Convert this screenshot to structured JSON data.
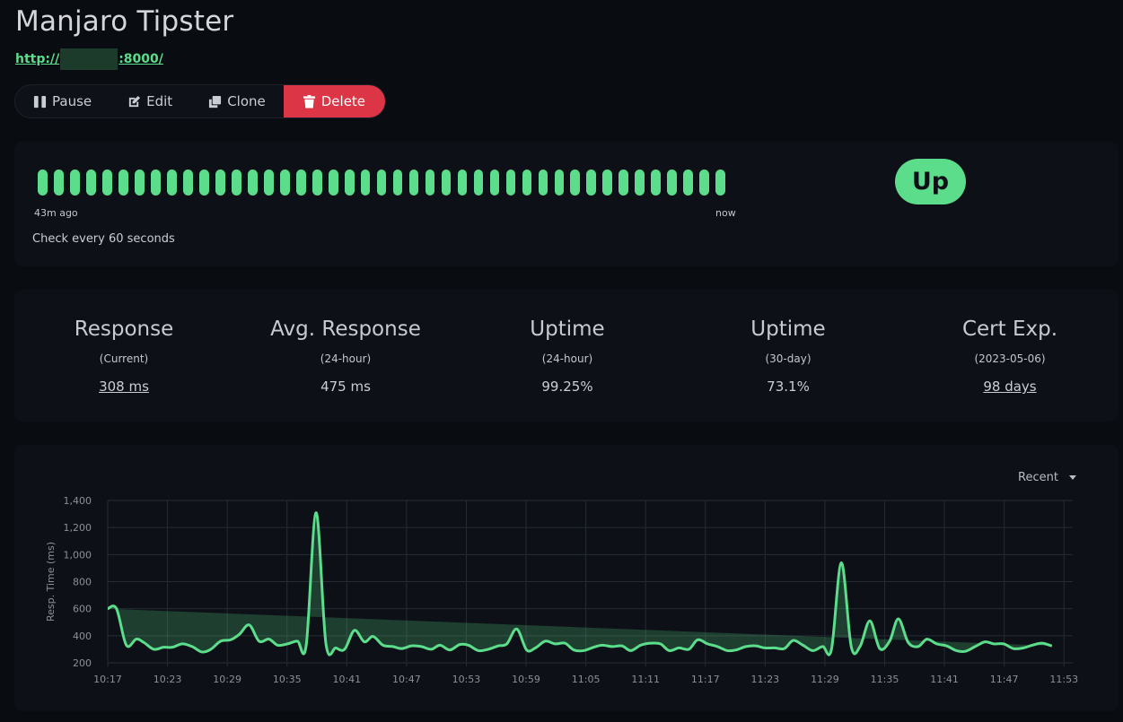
{
  "monitor": {
    "title": "Manjaro Tipster",
    "url_prefix": "http://",
    "url_suffix": ":8000/"
  },
  "actions": {
    "pause": "Pause",
    "edit": "Edit",
    "clone": "Clone",
    "delete": "Delete"
  },
  "heartbeat": {
    "count": 43,
    "status_color": "#5cdd8b",
    "start_label": "43m ago",
    "end_label": "now",
    "interval_text": "Check every 60 seconds",
    "status": "Up"
  },
  "stats": [
    {
      "title": "Response",
      "sub": "(Current)",
      "value": "308 ms",
      "link": true
    },
    {
      "title": "Avg. Response",
      "sub": "(24-hour)",
      "value": "475 ms",
      "link": false
    },
    {
      "title": "Uptime",
      "sub": "(24-hour)",
      "value": "99.25%",
      "link": false
    },
    {
      "title": "Uptime",
      "sub": "(30-day)",
      "value": "73.1%",
      "link": false
    },
    {
      "title": "Cert Exp.",
      "sub": "(2023-05-06)",
      "value": "98 days",
      "link": true
    }
  ],
  "chart_range": "Recent",
  "chart_data": {
    "type": "area",
    "ylabel": "Resp. Time (ms)",
    "ylim": [
      200,
      1400
    ],
    "yticks": [
      200,
      400,
      600,
      800,
      1000,
      1200,
      1400
    ],
    "ytick_labels": [
      "200",
      "400",
      "600",
      "800",
      "1,000",
      "1,200",
      "1,400"
    ],
    "xlim": [
      10.5,
      98.5
    ],
    "xticks": [
      10.5,
      16.5,
      22.5,
      28.5,
      34.5,
      40.5,
      46.5,
      52.5,
      58.5,
      64.5,
      70.5,
      76.5,
      82.5,
      88.5,
      94.5
    ],
    "xtick_labels": [
      "10:17",
      "10:23",
      "10:29",
      "10:35",
      "10:41",
      "10:47",
      "10:53",
      "10:59",
      "11:05",
      "11:11",
      "11:17",
      "11:23",
      "11:29",
      "11:35",
      "11:41",
      "11:47",
      "11:53"
    ],
    "grid": true,
    "color": "#5cdd8b",
    "x": [
      10.5,
      11.3,
      12.2,
      13.1,
      13.8,
      14.7,
      15.6,
      16.4,
      17.3,
      18.2,
      19.1,
      19.9,
      20.8,
      21.7,
      22.5,
      23.4,
      24.3,
      25.2,
      26.0,
      26.9,
      27.8,
      28.6,
      29.5,
      30.4,
      31.3,
      32.1,
      33.0,
      33.9,
      34.7,
      35.6,
      36.5,
      37.3,
      38.2,
      39.1,
      40.0,
      40.8,
      41.7,
      42.6,
      43.4,
      44.3,
      45.2,
      46.1,
      46.9,
      47.8,
      48.7,
      49.5,
      50.4,
      51.3,
      52.2,
      53.0,
      53.9,
      54.8,
      55.6,
      56.5,
      57.4,
      58.2,
      59.1,
      60.0,
      60.9,
      61.7,
      62.6,
      63.5,
      64.3,
      65.2,
      66.1,
      67.0,
      67.8,
      68.7,
      69.6,
      70.4,
      71.3,
      72.2,
      73.0,
      73.9,
      74.8,
      75.7,
      76.5,
      77.4,
      78.3,
      79.1,
      80.0,
      80.9,
      81.8,
      82.6,
      83.5,
      84.4,
      85.2,
      86.1,
      87.0,
      87.9,
      88.7,
      89.6,
      90.5,
      91.3,
      92.2,
      93.1,
      94.0,
      94.8,
      95.7,
      96.6,
      97.4,
      98.3
    ],
    "values": [
      600,
      600,
      330,
      375,
      350,
      300,
      315,
      315,
      340,
      320,
      280,
      300,
      360,
      370,
      410,
      480,
      360,
      375,
      330,
      340,
      360,
      330,
      1310,
      340,
      310,
      300,
      440,
      355,
      395,
      330,
      320,
      305,
      325,
      320,
      300,
      330,
      295,
      335,
      330,
      290,
      300,
      325,
      340,
      450,
      295,
      310,
      360,
      340,
      345,
      295,
      290,
      315,
      330,
      320,
      325,
      290,
      330,
      345,
      340,
      290,
      310,
      300,
      370,
      340,
      320,
      290,
      295,
      320,
      325,
      310,
      310,
      305,
      365,
      330,
      290,
      320,
      300,
      940,
      320,
      320,
      510,
      305,
      360,
      525,
      350,
      320,
      375,
      340,
      325,
      290,
      285,
      320,
      355,
      340,
      340,
      305,
      310,
      330,
      345,
      325,
      310
    ]
  }
}
